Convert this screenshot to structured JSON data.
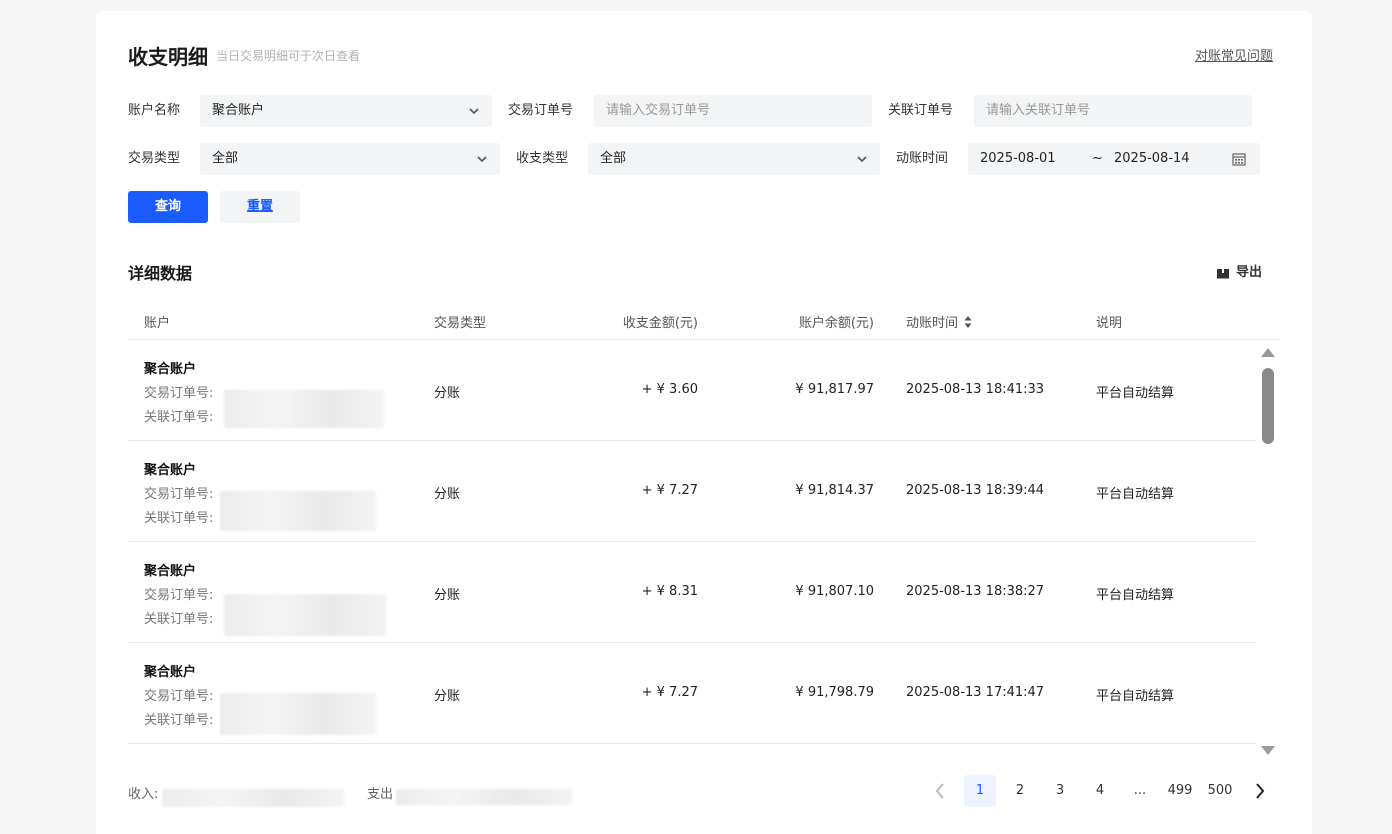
{
  "header": {
    "title": "收支明细",
    "subtitle": "当日交易明细可于次日查看",
    "faq_link": "对账常见问题"
  },
  "filters": {
    "account_name_label": "账户名称",
    "account_name_value": "聚合账户",
    "trade_order_label": "交易订单号",
    "trade_order_placeholder": "请输入交易订单号",
    "related_order_label": "关联订单号",
    "related_order_placeholder": "请输入关联订单号",
    "trade_type_label": "交易类型",
    "trade_type_value": "全部",
    "io_type_label": "收支类型",
    "io_type_value": "全部",
    "time_label": "动账时间",
    "date_start": "2025-08-01",
    "date_sep": "~",
    "date_end": "2025-08-14",
    "query_button": "查询",
    "reset_button": "重置"
  },
  "details": {
    "title": "详细数据",
    "export_label": "导出",
    "columns": [
      "账户",
      "交易类型",
      "收支金额(元)",
      "账户余额(元)",
      "动账时间",
      "说明"
    ],
    "trade_order_label": "交易订单号:",
    "related_order_label": "关联订单号:",
    "rows": [
      {
        "account": "聚合账户",
        "type": "分账",
        "amount": "+ ¥ 3.60",
        "balance": "¥ 91,817.97",
        "time": "2025-08-13 18:41:33",
        "note": "平台自动结算"
      },
      {
        "account": "聚合账户",
        "type": "分账",
        "amount": "+ ¥ 7.27",
        "balance": "¥ 91,814.37",
        "time": "2025-08-13 18:39:44",
        "note": "平台自动结算"
      },
      {
        "account": "聚合账户",
        "type": "分账",
        "amount": "+ ¥ 8.31",
        "balance": "¥ 91,807.10",
        "time": "2025-08-13 18:38:27",
        "note": "平台自动结算"
      },
      {
        "account": "聚合账户",
        "type": "分账",
        "amount": "+ ¥ 7.27",
        "balance": "¥ 91,798.79",
        "time": "2025-08-13 17:41:47",
        "note": "平台自动结算"
      }
    ]
  },
  "footer": {
    "income_label": "收入:",
    "expense_label": "支出",
    "pages": [
      "1",
      "2",
      "3",
      "4",
      "...",
      "499",
      "500"
    ],
    "current_page": "1"
  },
  "colors": {
    "primary": "#1a5cff",
    "field_bg": "#f2f4f5"
  }
}
